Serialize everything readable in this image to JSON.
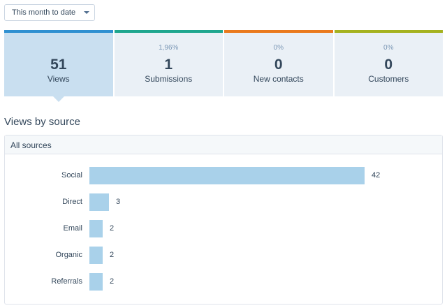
{
  "period_select": {
    "value": "This month to date"
  },
  "kpis": [
    {
      "pct": "",
      "value": "51",
      "label": "Views",
      "color": "#2f90d1",
      "active": true
    },
    {
      "pct": "1,96%",
      "value": "1",
      "label": "Submissions",
      "color": "#1fa68e",
      "active": false
    },
    {
      "pct": "0%",
      "value": "0",
      "label": "New contacts",
      "color": "#ea7a1d",
      "active": false
    },
    {
      "pct": "0%",
      "value": "0",
      "label": "Customers",
      "color": "#a5b21f",
      "active": false
    }
  ],
  "section_title": "Views by source",
  "panel_header": "All sources",
  "chart_data": {
    "type": "bar",
    "orientation": "horizontal",
    "categories": [
      "Social",
      "Direct",
      "Email",
      "Organic",
      "Referrals"
    ],
    "values": [
      42,
      3,
      2,
      2,
      2
    ],
    "bar_color": "#a9d1ea"
  }
}
